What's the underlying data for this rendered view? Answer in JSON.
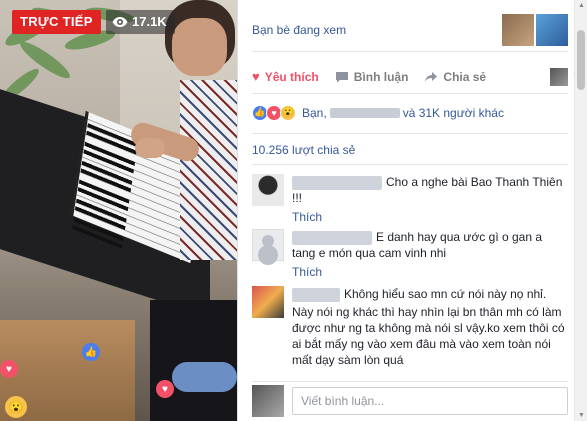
{
  "video": {
    "live_label": "TRỰC TIẾP",
    "viewer_count": "17.1K",
    "icons": {
      "eye": "eye-icon",
      "heart": "heart-icon",
      "like": "like-icon",
      "wow": "wow-icon"
    }
  },
  "panel": {
    "viewers_label": "Bạn bè đang xem",
    "actions": {
      "like": "Yêu thích",
      "comment": "Bình luận",
      "share": "Chia sẻ"
    },
    "reactions": {
      "prefix": "Bạn,",
      "suffix": "và 31K người khác"
    },
    "shares": "10.256 lượt chia sẻ",
    "comments": [
      {
        "text": "Cho a nghe bài Bao Thanh Thiên !!!",
        "reply": "Thích"
      },
      {
        "text": "E danh hay qua ước gì o gan a tang e món qua cam vinh nhi",
        "reply": "Thích"
      },
      {
        "text": "Không hiểu sao mn cứ nói này nọ nhỉ.",
        "text2": "Này nói ng khác thì hay nhìn lại bn thân mh có làm được như ng ta không mà nói sl vậy.ko xem thôi có ai bắt mấy ng vào xem đâu mà vào xem toàn nói mất dạy sàm lòn quá"
      }
    ],
    "composer_placeholder": "Viết bình luận..."
  },
  "colors": {
    "live": "#e02424",
    "link": "#365899",
    "love": "#f25268",
    "like": "#4a7ef0"
  }
}
